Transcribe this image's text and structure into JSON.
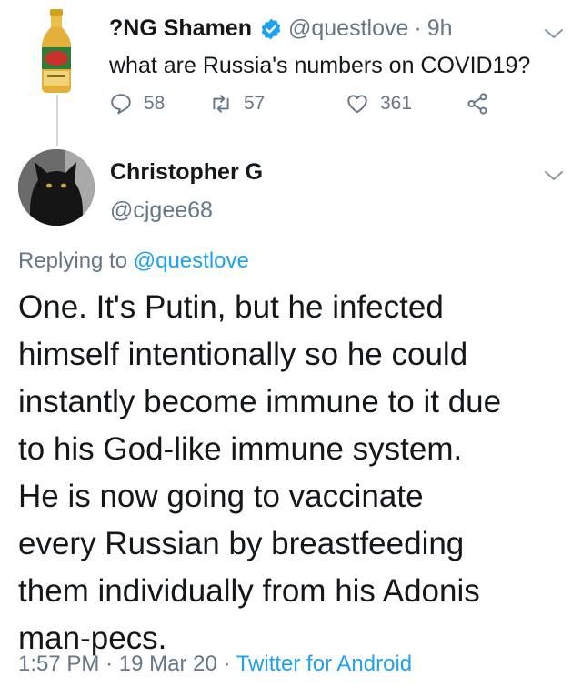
{
  "parent_tweet": {
    "display_name": "?NG Shamen",
    "handle": "@questlove",
    "separator": "·",
    "time": "9h",
    "text": "what are Russia's numbers on COVID19?",
    "avatar_icon": "ginger-ale-bottle-icon",
    "counts": {
      "replies": "58",
      "retweets": "57",
      "likes": "361"
    }
  },
  "reply_tweet": {
    "display_name": "Christopher G",
    "handle": "@cjgee68",
    "avatar_icon": "black-cat-avatar",
    "replying_prefix": "Replying to",
    "replying_to": "@questlove",
    "text_lines": [
      "One. It's Putin, but he infected",
      "himself intentionally so he could",
      "instantly become immune to it due",
      "to his God-like immune system.",
      "He is now going to vaccinate",
      "every Russian by breastfeeding",
      "them individually from his Adonis",
      "man-pecs."
    ],
    "time": "1:57 PM",
    "separator": "·",
    "date": "19 Mar 20",
    "source": "Twitter for Android"
  },
  "colors": {
    "text": "#14171a",
    "secondary": "#657786",
    "accent": "#1da1f2",
    "thread_line": "#cfd9de"
  }
}
